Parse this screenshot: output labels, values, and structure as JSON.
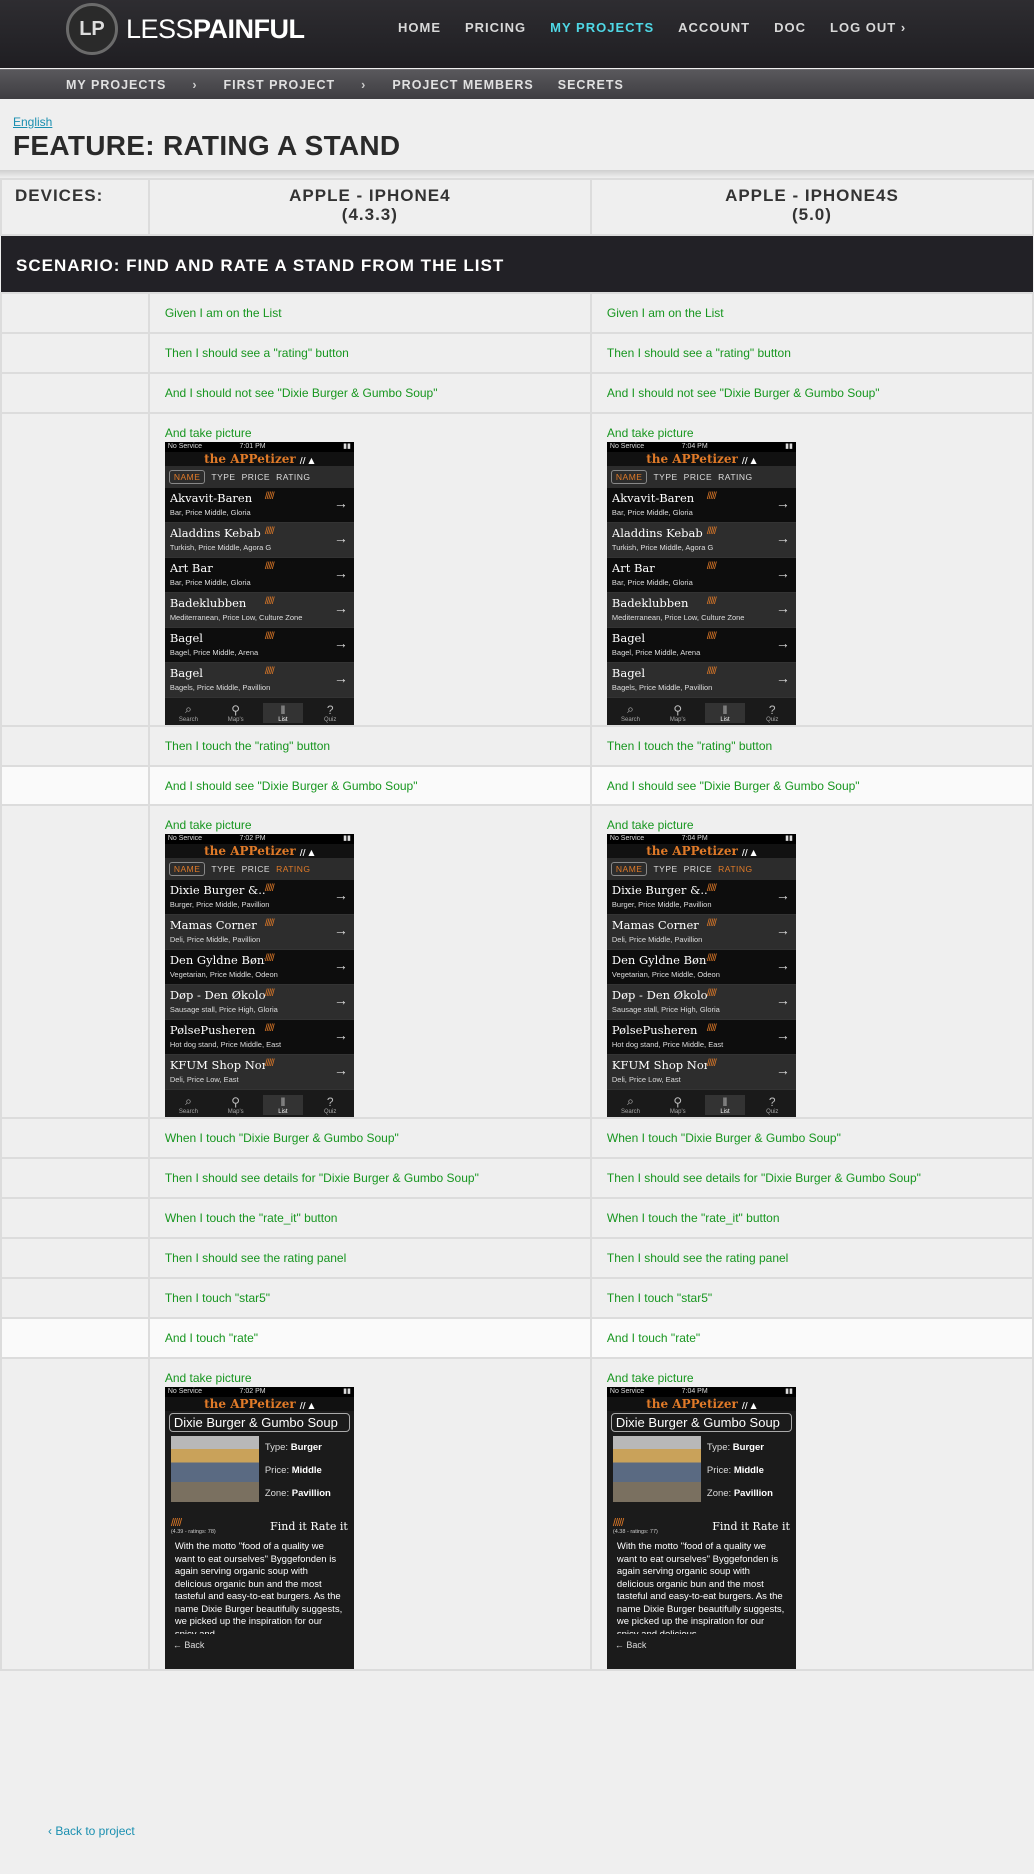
{
  "brand": {
    "logo_mark": "LP",
    "name_light": "LESS",
    "name_bold": "PAINFUL"
  },
  "main_nav": [
    {
      "label": "HOME",
      "active": false
    },
    {
      "label": "PRICING",
      "active": false
    },
    {
      "label": "MY PROJECTS",
      "active": true
    },
    {
      "label": "ACCOUNT",
      "active": false
    },
    {
      "label": "DOC",
      "active": false
    },
    {
      "label": "LOG OUT ›",
      "active": false
    }
  ],
  "breadcrumb": {
    "items": [
      "MY PROJECTS",
      "FIRST PROJECT",
      "PROJECT MEMBERS",
      "SECRETS"
    ],
    "separator": "›"
  },
  "language_link": "English",
  "feature_title": "FEATURE: RATING A STAND",
  "devices_label": "DEVICES:",
  "devices": [
    {
      "name": "APPLE - IPHONE4",
      "version": "(4.3.3)"
    },
    {
      "name": "APPLE - IPHONE4S",
      "version": "(5.0)"
    }
  ],
  "scenario_title": "SCENARIO: FIND AND RATE A STAND FROM THE LIST",
  "steps": {
    "s1": "Given I am on the List",
    "s2": "Then I should see a \"rating\" button",
    "s3": "And I should not see \"Dixie Burger & Gumbo Soup\"",
    "s4": "And take picture",
    "s5": "Then I touch the \"rating\" button",
    "s6": "And I should see \"Dixie Burger & Gumbo Soup\"",
    "s7": "And take picture",
    "s8": "When I touch \"Dixie Burger & Gumbo Soup\"",
    "s9": "Then I should see details for \"Dixie Burger & Gumbo Soup\"",
    "s10": "When I touch the \"rate_it\" button",
    "s11": "Then I should see the rating panel",
    "s12": "Then I touch \"star5\"",
    "s13": "And I touch \"rate\"",
    "s14": "And take picture"
  },
  "phone_common": {
    "carrier": "No Service",
    "app_title": "the APPetizer",
    "tabs": [
      "NAME",
      "TYPE",
      "PRICE",
      "RATING"
    ],
    "tabbar": [
      "Search",
      "Map's",
      "List",
      "Quiz"
    ],
    "stars_glyph": "/////",
    "arrow": "→"
  },
  "shots": {
    "list1": {
      "times": [
        "7:01 PM",
        "7:04 PM"
      ],
      "rows": [
        {
          "name": "Akvavit-Baren",
          "desc": "Bar, Price Middle, Gloria"
        },
        {
          "name": "Aladdins Kebab",
          "desc": "Turkish, Price Middle, Agora G"
        },
        {
          "name": "Art Bar",
          "desc": "Bar, Price Middle, Gloria"
        },
        {
          "name": "Badeklubben",
          "desc": "Mediterranean, Price Low, Culture Zone"
        },
        {
          "name": "Bagel",
          "desc": "Bagel, Price Middle, Arena"
        },
        {
          "name": "Bagel",
          "desc": "Bagels, Price Middle, Pavillion"
        }
      ]
    },
    "list2": {
      "times": [
        "7:02 PM",
        "7:04 PM"
      ],
      "rows": [
        {
          "name": "Dixie Burger &...",
          "desc": "Burger, Price Middle, Pavillion"
        },
        {
          "name": "Mamas Corner",
          "desc": "Deli, Price Middle, Pavillion"
        },
        {
          "name": "Den Gyldne Bønne",
          "desc": "Vegetarian, Price Middle, Odeon"
        },
        {
          "name": "Døp - Den Økologi...",
          "desc": "Sausage stall, Price High, Gloria"
        },
        {
          "name": "PølsePusheren",
          "desc": "Hot dog stand, Price Middle, East"
        },
        {
          "name": "KFUM Shop Non...",
          "desc": "Deli, Price Low, East"
        }
      ]
    },
    "detail": {
      "times": [
        "7:02 PM",
        "7:04 PM"
      ],
      "title": "Dixie Burger & Gumbo Soup",
      "type_label": "Type:",
      "type_value": "Burger",
      "price_label": "Price:",
      "price_value": "Middle",
      "zone_label": "Zone:",
      "zone_value": "Pavillion",
      "ratings": [
        "(4.39 - ratings: 78)",
        "(4.38 - ratings: 77)"
      ],
      "find_it": "Find it",
      "rate_it": "Rate it",
      "texts": [
        "With the motto \"food of a quality we want to eat ourselves\" Byggefonden is again serving organic soup with delicious organic bun and the most tasteful and easy-to-eat burgers. As the name Dixie Burger beautifully suggests, we picked up the inspiration for our spicy and",
        "With the motto \"food of a quality we want to eat ourselves\" Byggefonden is again serving organic soup with delicious organic bun and the most tasteful and easy-to-eat burgers. As the name Dixie Burger beautifully suggests, we picked up the inspiration for our spicy and delicious"
      ],
      "back": "Back"
    }
  },
  "back_to_project": "‹ Back to project",
  "colors": {
    "accent": "#4fd8e6",
    "step_text": "#17961f",
    "link": "#1a8fb0",
    "app_orange": "#e07a28"
  }
}
